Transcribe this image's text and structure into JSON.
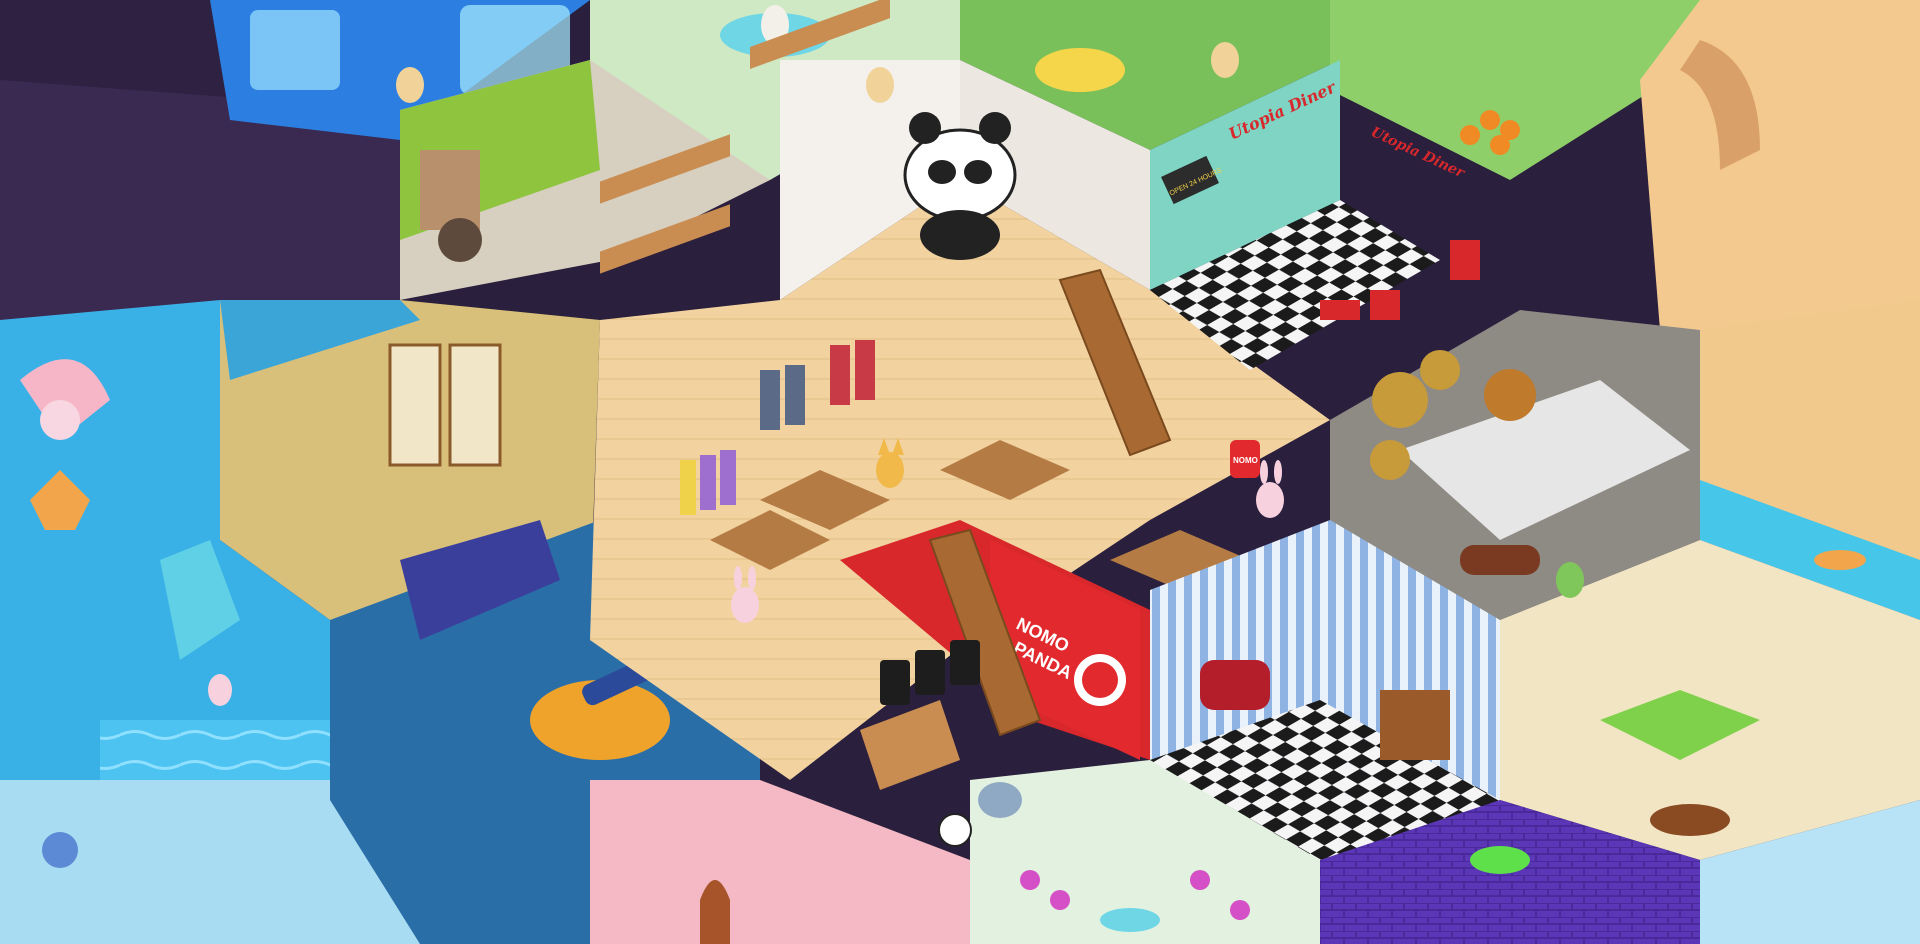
{
  "scene": {
    "description_free": true,
    "signs": {
      "diner_sign_1": "Utopia Diner",
      "diner_sign_2": "Utopia Diner",
      "diner_board": "OPEN 24 HOURS"
    },
    "store_banner": {
      "line1": "NOMO",
      "line2": "PANDA"
    },
    "store_pillow_text": "NOMO"
  },
  "colors": {
    "wall_white": "#f4f1ec",
    "floor_wood": "#f2d3a0",
    "red_carpet": "#d8282c",
    "diner_teal": "#7fd4c3",
    "checker_black": "#1b1b1b",
    "checker_white": "#f5f5f5",
    "underwater_blue": "#3ab1e6",
    "night_purple": "#2f2142",
    "garden_green": "#74b84a",
    "beach_sand": "#f1c98c",
    "steampunk_grey": "#8e8a84",
    "library_blue": "#3b67c0",
    "witch_purple": "#5b2fa0"
  }
}
